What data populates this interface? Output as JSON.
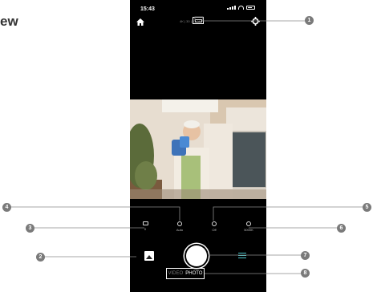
{
  "doc": {
    "title_fragment": "ew"
  },
  "status_bar": {
    "time": "15:43"
  },
  "camera_info": {
    "text": "4K | 30 | 12.0MP"
  },
  "settings": [
    {
      "label": "0",
      "icon": "exposure-icon"
    },
    {
      "label": "Auto",
      "icon": "focus-icon"
    },
    {
      "label": "Off",
      "icon": "timer-icon"
    },
    {
      "label": "5000K",
      "icon": "white-balance-icon"
    }
  ],
  "modes": {
    "video": "VIDEO",
    "photo": "PHOTO"
  },
  "callouts": [
    "1",
    "2",
    "3",
    "4",
    "5",
    "6",
    "7",
    "8"
  ]
}
